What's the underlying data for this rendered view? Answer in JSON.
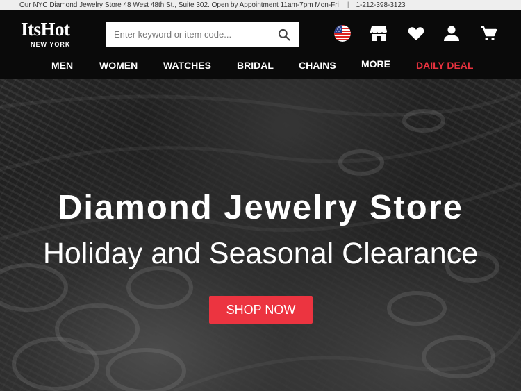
{
  "topbar": {
    "store_info": "Our NYC Diamond Jewelry Store 48 West 48th St., Suite 302. Open by Appointment 11am-7pm Mon-Fri",
    "separator": "|",
    "phone": "1-212-398-3123"
  },
  "header": {
    "logo": {
      "brand": "ItsHot",
      "sub": "NEW YORK"
    },
    "search": {
      "placeholder": "Enter keyword or item code...",
      "value": ""
    },
    "icons": [
      "us-flag-icon",
      "store-icon",
      "heart-icon",
      "account-icon",
      "cart-icon"
    ]
  },
  "nav": {
    "items": [
      "MEN",
      "WOMEN",
      "WATCHES",
      "BRIDAL",
      "CHAINS",
      "MORE"
    ],
    "deal": "DAILY DEAL"
  },
  "hero": {
    "title": "Diamond Jewelry Store",
    "subtitle": "Holiday and Seasonal Clearance",
    "cta": "SHOP NOW"
  },
  "colors": {
    "accent": "#ec3440",
    "header_bg": "#0a0a0a",
    "topbar_bg": "#eeeeee"
  }
}
